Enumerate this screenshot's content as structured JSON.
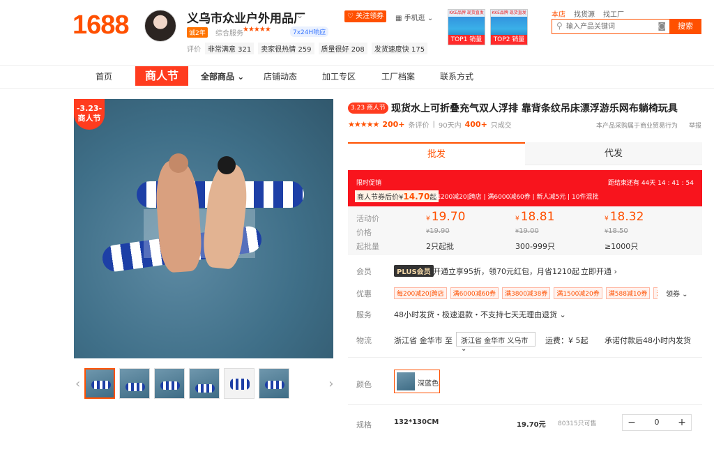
{
  "header": {
    "logo": "1688",
    "shop_name": "义乌市众业户外用品厂",
    "years_badge": "诚2年",
    "service_label": "综合服务",
    "stars": "★★★★★",
    "response_badge": "7x24H响应",
    "eval_label": "评价",
    "evals": [
      "非常满意 321",
      "卖家很热情 259",
      "质量很好 208",
      "发货速度快 175"
    ],
    "follow_label": "关注领券",
    "mobile_label": "手机逛",
    "promo_cards": [
      {
        "title": "KKE品牌 现货直发",
        "tag": "TOP1 销量"
      },
      {
        "title": "KKE品牌 现货直发",
        "tag": "TOP2 销量"
      }
    ],
    "search_tabs": [
      "本店",
      "找货源",
      "找工厂"
    ],
    "search_placeholder": "输入产品关键词",
    "search_button": "搜索"
  },
  "nav": {
    "items": [
      "首页",
      "全部商品",
      "店铺动态",
      "加工专区",
      "工厂档案",
      "联系方式"
    ],
    "festival_logo": "商人节"
  },
  "gallery": {
    "festival_badge_date": "-3.23-",
    "festival_badge_text": "商人节",
    "thumb_count": 6,
    "selected_index": 0
  },
  "product": {
    "badge": "3.23 商人节",
    "title": "现货水上可折叠充气双人浮排 靠背条纹吊床漂浮游乐网布躺椅玩具",
    "stars": "★★★★★",
    "reviews_count": "200+",
    "reviews_label": "条评价",
    "sold_period": "90天内",
    "sold_count": "400+",
    "sold_label": "只成交",
    "notice": "本产品采购属于商业贸易行为",
    "report": "举报"
  },
  "tabs": {
    "wholesale": "批发",
    "dropship": "代发"
  },
  "promo": {
    "limited_label": "限时促销",
    "countdown": "距结束还有 44天 14 : 41 : 54",
    "coupon_prefix": "商人节券后价¥",
    "coupon_price": "14.70",
    "coupon_suffix": "起",
    "rules": "每200减20|跨店 | 满6000减60券 | 新人减5元 | 10件混批"
  },
  "pricing": {
    "activity_label": "活动价",
    "price_label": "价格",
    "batch_label": "起批量",
    "currency": "¥",
    "tiers": [
      {
        "activity": "19.70",
        "original": "19.90",
        "batch": "2只起批"
      },
      {
        "activity": "18.81",
        "original": "19.00",
        "batch": "300-999只"
      },
      {
        "activity": "18.32",
        "original": "18.50",
        "batch": "≥1000只"
      }
    ]
  },
  "member": {
    "label": "会员",
    "badge": "PLUS会员",
    "text": "开通立享95折，领70元红包，月省1210起",
    "open": "立即开通 ›"
  },
  "discount": {
    "label": "优惠",
    "coupons": [
      "每200减20|跨店",
      "满6000减60券",
      "满3800减38券",
      "满1500减20券",
      "满588减10券",
      "满3"
    ],
    "more": "领券 ⌄"
  },
  "service": {
    "label": "服务",
    "text": "48小时发货・极速退款・不支持七天无理由退货 ⌄"
  },
  "logistics": {
    "label": "物流",
    "from": "浙江省 金华市",
    "to_label": "至",
    "destination": "浙江省 金华市 义乌市  ⌄",
    "fee": "运费：¥ 5起",
    "promise": "承诺付款后48小时内发货"
  },
  "color": {
    "label": "颜色",
    "option": "深蓝色"
  },
  "spec": {
    "label": "规格",
    "name": "132*130CM",
    "price": "19.70元",
    "stock": "80315只可售",
    "quantity": "0",
    "minus": "−",
    "plus": "+"
  }
}
